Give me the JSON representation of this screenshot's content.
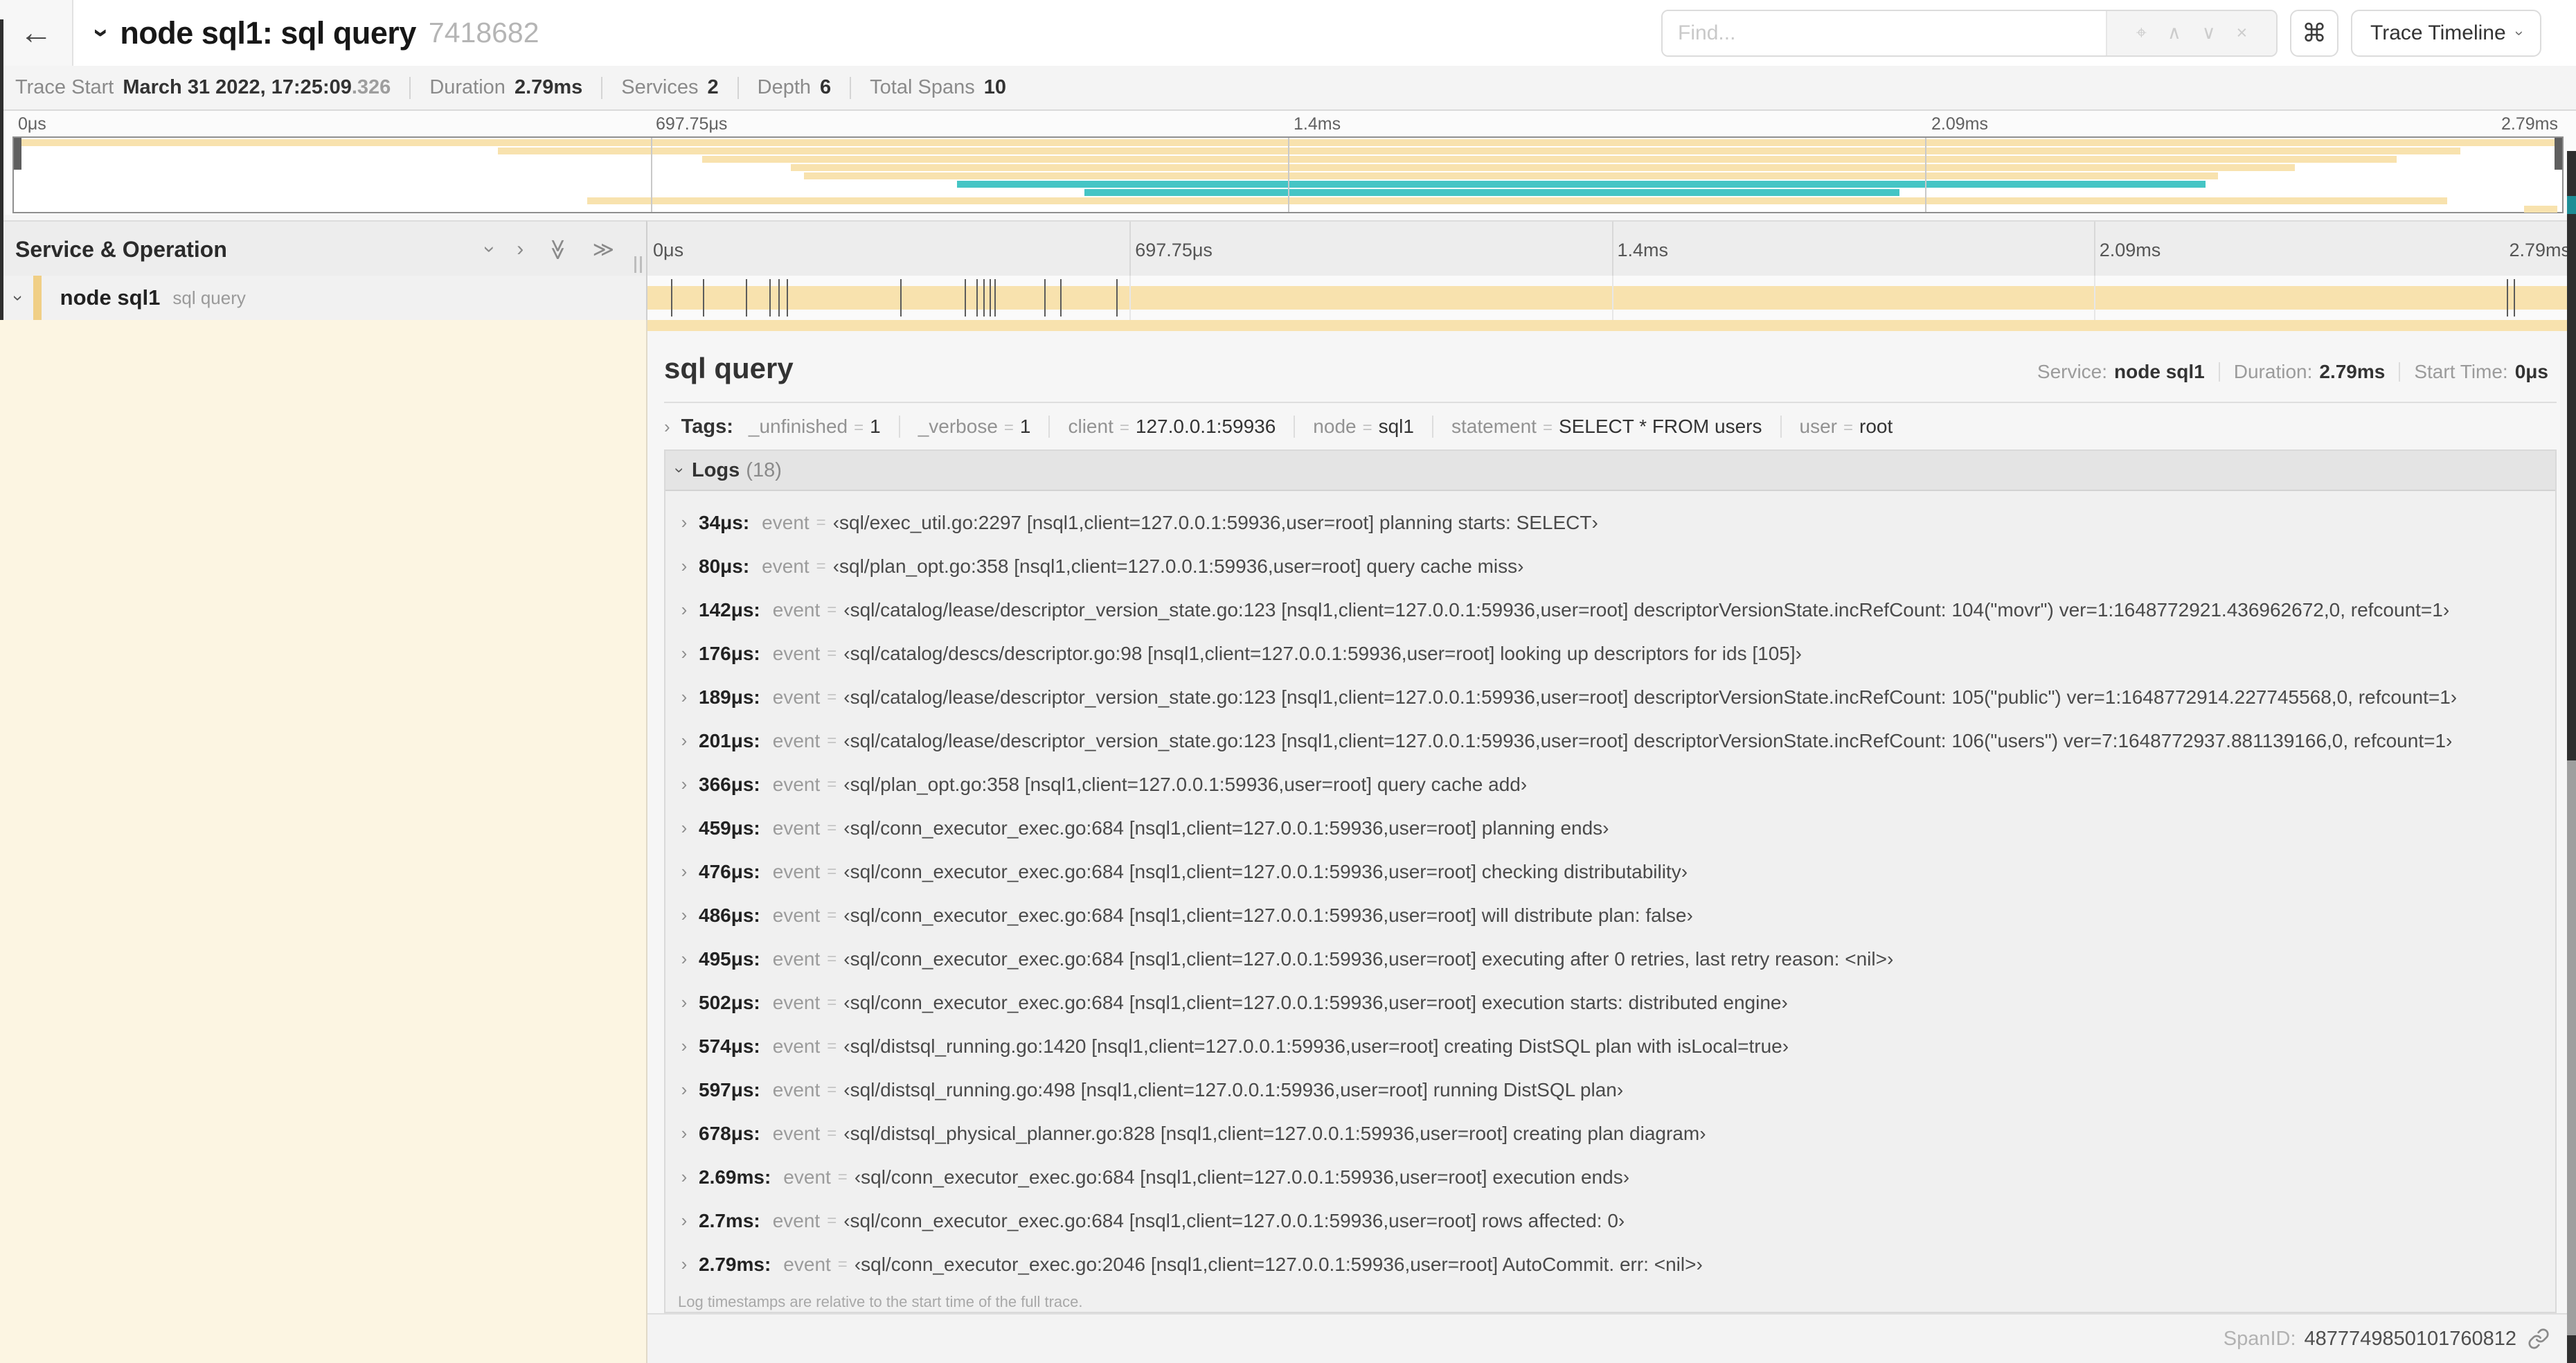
{
  "colors": {
    "yellow": "#F8E2AE",
    "teal": "#45C5C5",
    "accent_yellow": "#F0CF86",
    "cream": "#FCF5E2"
  },
  "header": {
    "back_icon": "arrow-left",
    "title": "node sql1: sql query",
    "trace_id": "7418682",
    "find_placeholder": "Find...",
    "shortcut": "⌘",
    "view_label": "Trace Timeline"
  },
  "summary": {
    "items": [
      {
        "label": "Trace Start",
        "value": "March 31 2022, 17:25:09",
        "suffix": ".326"
      },
      {
        "label": "Duration",
        "value": "2.79ms",
        "suffix": ""
      },
      {
        "label": "Services",
        "value": "2",
        "suffix": ""
      },
      {
        "label": "Depth",
        "value": "6",
        "suffix": ""
      },
      {
        "label": "Total Spans",
        "value": "10",
        "suffix": ""
      }
    ]
  },
  "timeline": {
    "ticks": [
      {
        "label": "0μs",
        "pct": 0
      },
      {
        "label": "697.75μs",
        "pct": 25
      },
      {
        "label": "1.4ms",
        "pct": 50
      },
      {
        "label": "2.09ms",
        "pct": 75
      },
      {
        "label": "2.79ms",
        "pct": 100
      }
    ],
    "minimap_rows": [
      {
        "start": 0,
        "end": 100,
        "color": "yellow"
      },
      {
        "start": 19,
        "end": 96,
        "color": "yellow"
      },
      {
        "start": 27,
        "end": 93.5,
        "color": "yellow"
      },
      {
        "start": 30.5,
        "end": 89.5,
        "color": "yellow"
      },
      {
        "start": 31,
        "end": 86.5,
        "color": "yellow"
      },
      {
        "start": 37,
        "end": 86,
        "color": "teal"
      },
      {
        "start": 42,
        "end": 74,
        "color": "teal"
      },
      {
        "start": 22.5,
        "end": 95.5,
        "color": "yellow"
      },
      {
        "start": 98.5,
        "end": 99.8,
        "color": "yellow"
      }
    ]
  },
  "span_table": {
    "header_label": "Service & Operation",
    "row": {
      "service": "node sql1",
      "operation": "sql query",
      "log_marks_pct": [
        1.22,
        2.87,
        5.09,
        6.31,
        6.78,
        7.2,
        13.12,
        16.45,
        17.06,
        17.42,
        17.74,
        18.0,
        20.57,
        21.4,
        24.3,
        96.42,
        96.77,
        99.8
      ]
    }
  },
  "detail": {
    "operation": "sql query",
    "service_label": "Service:",
    "service": "node sql1",
    "duration_label": "Duration:",
    "duration": "2.79ms",
    "start_label": "Start Time:",
    "start": "0μs",
    "tags_label": "Tags:",
    "tags": [
      {
        "key": "_unfinished",
        "value": "1"
      },
      {
        "key": "_verbose",
        "value": "1"
      },
      {
        "key": "client",
        "value": "127.0.0.1:59936"
      },
      {
        "key": "node",
        "value": "sql1"
      },
      {
        "key": "statement",
        "value": "SELECT * FROM users"
      },
      {
        "key": "user",
        "value": "root"
      }
    ],
    "logs_label": "Logs",
    "logs_count": "(18)",
    "log_field_key": "event",
    "logs": [
      {
        "time": "34μs:",
        "value": "‹sql/exec_util.go:2297 [nsql1,client=127.0.0.1:59936,user=root] planning starts: SELECT›"
      },
      {
        "time": "80μs:",
        "value": "‹sql/plan_opt.go:358 [nsql1,client=127.0.0.1:59936,user=root] query cache miss›"
      },
      {
        "time": "142μs:",
        "value": "‹sql/catalog/lease/descriptor_version_state.go:123 [nsql1,client=127.0.0.1:59936,user=root] descriptorVersionState.incRefCount: 104(\"movr\") ver=1:1648772921.436962672,0, refcount=1›"
      },
      {
        "time": "176μs:",
        "value": "‹sql/catalog/descs/descriptor.go:98 [nsql1,client=127.0.0.1:59936,user=root] looking up descriptors for ids [105]›"
      },
      {
        "time": "189μs:",
        "value": "‹sql/catalog/lease/descriptor_version_state.go:123 [nsql1,client=127.0.0.1:59936,user=root] descriptorVersionState.incRefCount: 105(\"public\") ver=1:1648772914.227745568,0, refcount=1›"
      },
      {
        "time": "201μs:",
        "value": "‹sql/catalog/lease/descriptor_version_state.go:123 [nsql1,client=127.0.0.1:59936,user=root] descriptorVersionState.incRefCount: 106(\"users\") ver=7:1648772937.881139166,0, refcount=1›"
      },
      {
        "time": "366μs:",
        "value": "‹sql/plan_opt.go:358 [nsql1,client=127.0.0.1:59936,user=root] query cache add›"
      },
      {
        "time": "459μs:",
        "value": "‹sql/conn_executor_exec.go:684 [nsql1,client=127.0.0.1:59936,user=root] planning ends›"
      },
      {
        "time": "476μs:",
        "value": "‹sql/conn_executor_exec.go:684 [nsql1,client=127.0.0.1:59936,user=root] checking distributability›"
      },
      {
        "time": "486μs:",
        "value": "‹sql/conn_executor_exec.go:684 [nsql1,client=127.0.0.1:59936,user=root] will distribute plan: false›"
      },
      {
        "time": "495μs:",
        "value": "‹sql/conn_executor_exec.go:684 [nsql1,client=127.0.0.1:59936,user=root] executing after 0 retries, last retry reason: <nil>›"
      },
      {
        "time": "502μs:",
        "value": "‹sql/conn_executor_exec.go:684 [nsql1,client=127.0.0.1:59936,user=root] execution starts: distributed engine›"
      },
      {
        "time": "574μs:",
        "value": "‹sql/distsql_running.go:1420 [nsql1,client=127.0.0.1:59936,user=root] creating DistSQL plan with isLocal=true›"
      },
      {
        "time": "597μs:",
        "value": "‹sql/distsql_running.go:498 [nsql1,client=127.0.0.1:59936,user=root] running DistSQL plan›"
      },
      {
        "time": "678μs:",
        "value": "‹sql/distsql_physical_planner.go:828 [nsql1,client=127.0.0.1:59936,user=root] creating plan diagram›"
      },
      {
        "time": "2.69ms:",
        "value": "‹sql/conn_executor_exec.go:684 [nsql1,client=127.0.0.1:59936,user=root] execution ends›"
      },
      {
        "time": "2.7ms:",
        "value": "‹sql/conn_executor_exec.go:684 [nsql1,client=127.0.0.1:59936,user=root] rows affected: 0›"
      },
      {
        "time": "2.79ms:",
        "value": "‹sql/conn_executor_exec.go:2046 [nsql1,client=127.0.0.1:59936,user=root] AutoCommit. err: <nil>›"
      }
    ],
    "footer_note": "Log timestamps are relative to the start time of the full trace.",
    "spanid_label": "SpanID:",
    "spanid": "4877749850101760812"
  }
}
